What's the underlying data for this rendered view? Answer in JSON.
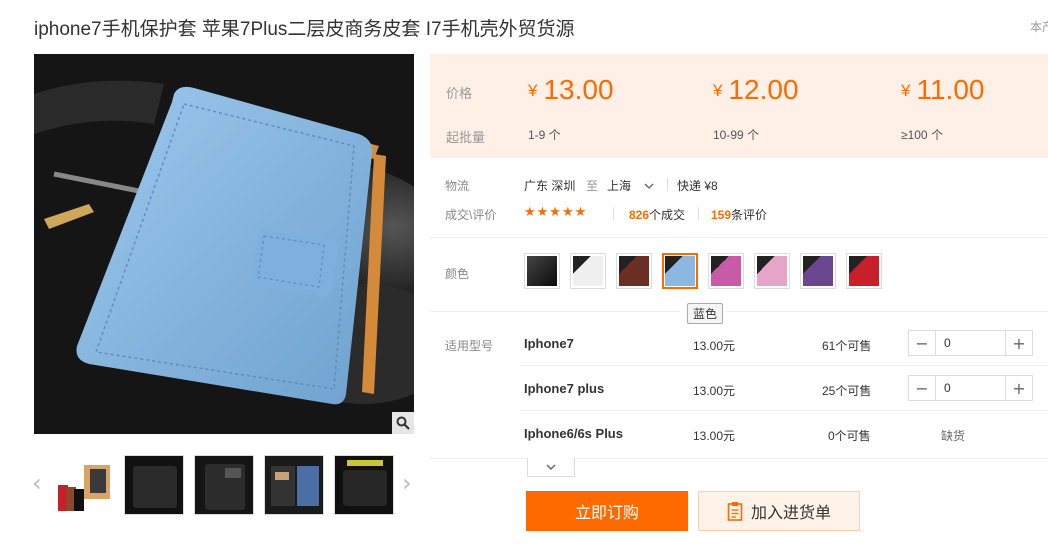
{
  "title": "iphone7手机保护套 苹果7Plus二层皮商务皮套 I7手机壳外贸货源",
  "corner_note": "本产",
  "price_panel": {
    "price_label": "价格",
    "moq_label": "起批量",
    "tiers": [
      {
        "currency": "¥",
        "price": "13.00",
        "qty": "1-9 个"
      },
      {
        "currency": "¥",
        "price": "12.00",
        "qty": "10-99 个"
      },
      {
        "currency": "¥",
        "price": "11.00",
        "qty": "≥100 个"
      }
    ]
  },
  "logistics": {
    "label": "物流",
    "from": "广东 深圳",
    "to_word": "至",
    "to": "上海",
    "method": "快递 ¥8"
  },
  "deals": {
    "label": "成交\\评价",
    "stars": "★★★★★",
    "sold_count": "826",
    "sold_suffix": "个成交",
    "review_count": "159",
    "review_suffix": "条评价"
  },
  "color": {
    "label": "颜色",
    "tooltip": "蓝色",
    "swatches": [
      {
        "color": "#1a1a1a"
      },
      {
        "color": "#e8e8e8"
      },
      {
        "color": "#5a2a1f"
      },
      {
        "color": "#8ab8e0",
        "selected": true
      },
      {
        "color": "#c85aa8"
      },
      {
        "color": "#e6a4c6"
      },
      {
        "color": "#6a4690"
      },
      {
        "color": "#c8202a"
      }
    ]
  },
  "models": {
    "label": "适用型号",
    "rows": [
      {
        "name": "Iphone7",
        "price": "13.00元",
        "stock": "61个可售",
        "qty": "0"
      },
      {
        "name": "Iphone7 plus",
        "price": "13.00元",
        "stock": "25个可售",
        "qty": "0"
      },
      {
        "name": "Iphone6/6s Plus",
        "price": "13.00元",
        "stock": "0个可售",
        "status": "缺货"
      }
    ]
  },
  "actions": {
    "buy": "立即订购",
    "cart": "加入进货单"
  },
  "colors": {
    "accent": "#ff6a00",
    "price_bg": "#fef0e6",
    "product": "#8ab8e0"
  }
}
